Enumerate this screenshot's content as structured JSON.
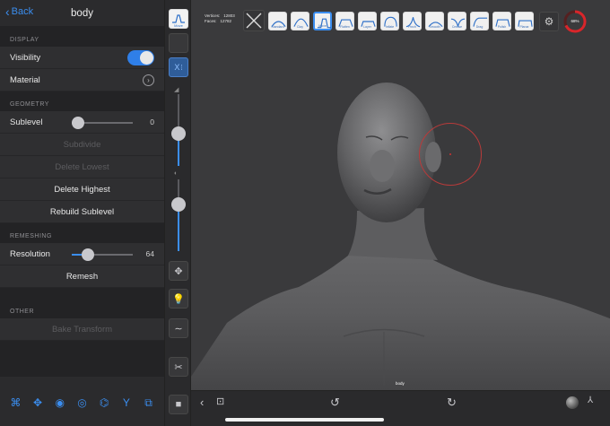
{
  "header": {
    "back_label": "Back",
    "title": "body"
  },
  "sections": {
    "display": "DISPLAY",
    "geometry": "GEOMETRY",
    "remeshing": "REMESHING",
    "other": "OTHER"
  },
  "display": {
    "visibility_label": "Visibility",
    "visibility_on": true,
    "material_label": "Material"
  },
  "geometry": {
    "sublevel_label": "Sublevel",
    "sublevel_value": "0",
    "subdivide_label": "Subdivide",
    "delete_lowest_label": "Delete Lowest",
    "delete_highest_label": "Delete Highest",
    "rebuild_label": "Rebuild Sublevel"
  },
  "remeshing": {
    "resolution_label": "Resolution",
    "resolution_value": "64",
    "remesh_label": "Remesh"
  },
  "other": {
    "bake_label": "Bake Transform"
  },
  "vtoolbar": {
    "move_label": "Move",
    "symmetry_label": "X",
    "radius_level": 0.45,
    "intensity_level": 0.65
  },
  "viewport": {
    "vertices_label": "Vertices:",
    "vertices_value": "12803",
    "faces_label": "Faces:",
    "faces_value": "12782",
    "brushes": [
      "Standard",
      "Clay",
      "Move",
      "Flatten",
      "Layer",
      "Inflate",
      "Pinch",
      "Smooth",
      "Crease",
      "Drag",
      "Polish",
      "Planar"
    ],
    "active_brush": "Move",
    "progress_label": "68%",
    "progress_value": 0.68,
    "object_label": "body"
  },
  "colors": {
    "accent": "#3b8ef0",
    "progress": "#d8262b"
  }
}
